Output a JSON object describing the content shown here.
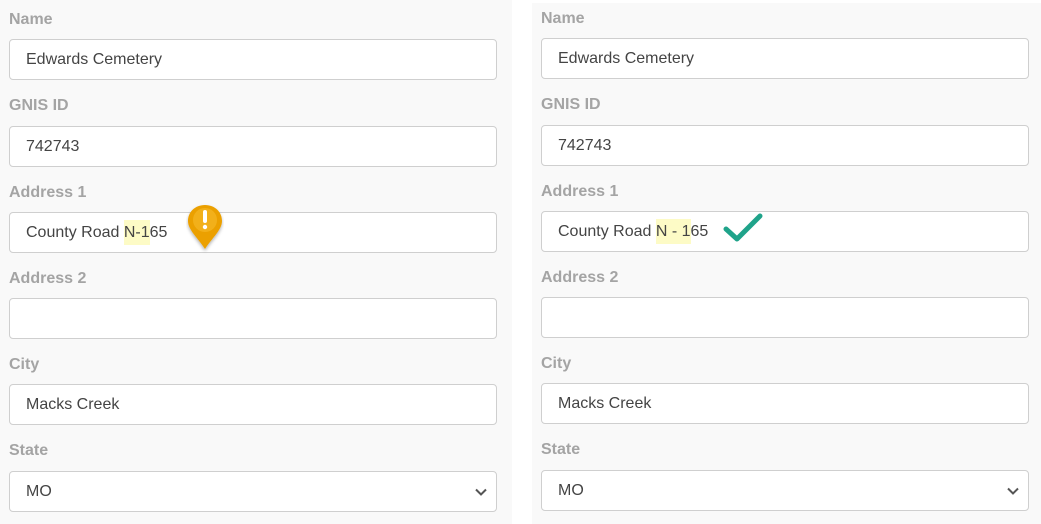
{
  "panels": [
    {
      "variant": "before",
      "fields": {
        "name": {
          "label": "Name",
          "value": "Edwards Cemetery"
        },
        "gnis": {
          "label": "GNIS ID",
          "value": "742743"
        },
        "address1": {
          "label": "Address 1",
          "value_pre": "County Road ",
          "value_hl": "N-1",
          "value_post": "65"
        },
        "address2": {
          "label": "Address 2",
          "value": ""
        },
        "city": {
          "label": "City",
          "value": "Macks Creek"
        },
        "state": {
          "label": "State",
          "value": "MO"
        }
      },
      "status_icon": "warning-pin-icon",
      "status_color": "#f0a500"
    },
    {
      "variant": "after",
      "fields": {
        "name": {
          "label": "Name",
          "value": "Edwards Cemetery"
        },
        "gnis": {
          "label": "GNIS ID",
          "value": "742743"
        },
        "address1": {
          "label": "Address 1",
          "value_pre": "County Road ",
          "value_hl": "N - 1",
          "value_post": "65"
        },
        "address2": {
          "label": "Address 2",
          "value": ""
        },
        "city": {
          "label": "City",
          "value": "Macks Creek"
        },
        "state": {
          "label": "State",
          "value": "MO"
        }
      },
      "status_icon": "checkmark-icon",
      "status_color": "#1fa38a"
    }
  ]
}
